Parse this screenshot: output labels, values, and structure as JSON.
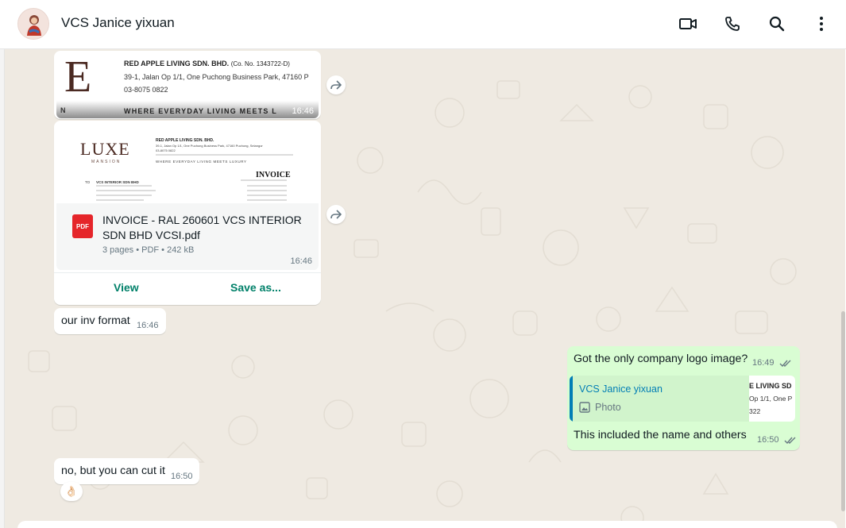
{
  "header": {
    "contact_name": "VCS Janice yixuan"
  },
  "icons": {
    "video": "video-call-icon",
    "call": "voice-call-icon",
    "search": "search-icon",
    "menu": "more-options-icon",
    "forward": "forward-icon",
    "ticks": "double-check-icon",
    "photo": "photo-icon",
    "pdf": "pdf-file-icon"
  },
  "colors": {
    "accent": "#008069",
    "outgoing_bubble": "#d9fdd3",
    "incoming_bubble": "#ffffff",
    "chat_background": "#efeae2",
    "quote_name": "#027eb5",
    "pdf_red": "#e5252a"
  },
  "messages": {
    "image1": {
      "letterhead_letter": "E",
      "company_line": "RED APPLE LIVING SDN. BHD.",
      "company_no": "(Co. No. 1343722-D)",
      "address": "39-1, Jalan Op 1/1, One Puchong Business Park, 47160 P",
      "phone": "03-8075 0822",
      "slogan": "WHERE EVERYDAY LIVING MEETS L",
      "slogan_left": "N",
      "time": "16:46"
    },
    "document": {
      "preview_logo": "LUXE",
      "preview_logo_sub": "MANSION",
      "preview_company": "RED APPLE LIVING SDN. BHD.",
      "preview_address": "39-1, Jalan Op 1/1, One Puchong Business Park, 47160 Puchong, Selangor",
      "preview_phone": "03-8075 0822",
      "preview_slogan": "WHERE EVERYDAY LIVING MEETS LUXURY",
      "preview_title": "INVOICE",
      "preview_to": "TO",
      "preview_customer": "VCS INTERIOR SDN BHD",
      "pdf_label": "PDF",
      "file_name_line1": "INVOICE - RAL 260601 VCS INTERIOR",
      "file_name_line2": "SDN BHD VCSI.pdf",
      "meta": "3 pages • PDF • 242 kB",
      "time": "16:46",
      "view_label": "View",
      "save_label": "Save as..."
    },
    "text1": {
      "text": "our inv format",
      "time": "16:46"
    },
    "out1": {
      "text": "Got the only company logo image?",
      "time": "16:49"
    },
    "out2": {
      "quote_name": "VCS Janice yixuan",
      "quote_type": "Photo",
      "quote_thumb_line1": "E LIVING SD",
      "quote_thumb_line2": "Op 1/1, One P",
      "quote_thumb_line3": "322",
      "text": "This included the name and others",
      "time": "16:50"
    },
    "text2": {
      "text": "no, but you can cut it",
      "time": "16:50",
      "reaction": "👌🏻"
    }
  }
}
